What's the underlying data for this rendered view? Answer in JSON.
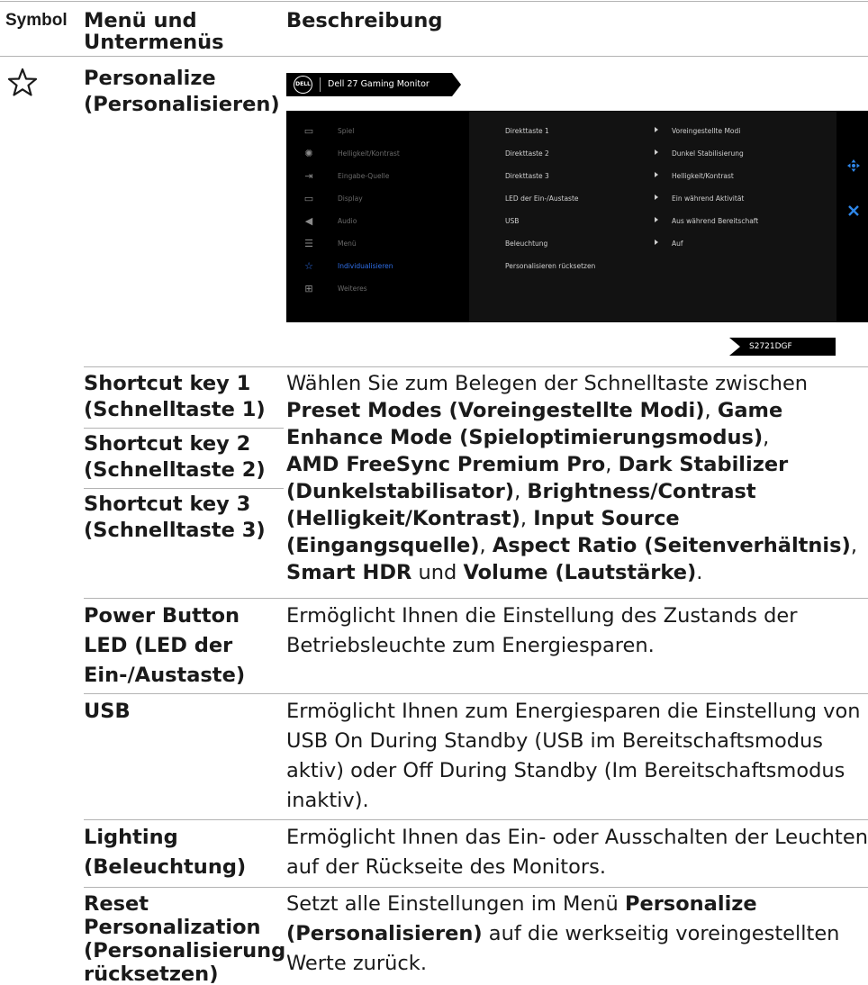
{
  "table": {
    "headers": {
      "symbol": "Symbol",
      "menu": "Menü und Untermenüs",
      "menu_line1": "Menü und",
      "menu_line2": "Untermenüs",
      "description": "Beschreibung"
    },
    "section": {
      "icon": "star-outline",
      "title_line1": "Personalize",
      "title_line2": "(Personalisieren)"
    }
  },
  "osd": {
    "brand": "DELL",
    "model_title": "Dell 27 Gaming Monitor",
    "model_code": "S2721DGF",
    "menu_items": [
      {
        "label": "Spiel",
        "icon": "game-icon"
      },
      {
        "label": "Helligkeit/Kontrast",
        "icon": "brightness-icon"
      },
      {
        "label": "Eingabe-Quelle",
        "icon": "input-icon"
      },
      {
        "label": "Display",
        "icon": "display-icon"
      },
      {
        "label": "Audio",
        "icon": "audio-icon"
      },
      {
        "label": "Menü",
        "icon": "menu-icon"
      },
      {
        "label": "Individualisieren",
        "icon": "star-icon",
        "active": true
      },
      {
        "label": "Weiteres",
        "icon": "others-icon"
      }
    ],
    "submenu": [
      {
        "label": "Direkttaste 1",
        "value": "Voreingestellte Modi"
      },
      {
        "label": "Direkttaste 2",
        "value": "Dunkel Stabilisierung"
      },
      {
        "label": "Direkttaste 3",
        "value": "Helligkeit/Kontrast"
      },
      {
        "label": "LED der Ein-/Austaste",
        "value": "Ein während Aktivität"
      },
      {
        "label": "USB",
        "value": "Aus während Bereitschaft"
      },
      {
        "label": "Beleuchtung",
        "value": "Auf"
      },
      {
        "label": "Personalisieren rücksetzen",
        "value": ""
      }
    ],
    "accent_color": "#2f6fe8"
  },
  "rows": {
    "shortcut": {
      "k1a": "Shortcut key 1",
      "k1b": "(Schnelltaste 1)",
      "k2a": "Shortcut key 2",
      "k2b": "(Schnelltaste 2)",
      "k3a": "Shortcut key 3",
      "k3b": "(Schnelltaste 3)",
      "desc": {
        "l1": "Wählen Sie zum Belegen der Schnelltaste zwischen",
        "l2a": "Preset Modes (Voreingestellte Modi)",
        "l2b": ", ",
        "l2c": "Game",
        "l3a": "Enhance Mode (Spieloptimierungsmodus)",
        "l3b": ",",
        "l4a": "AMD FreeSync Premium Pro",
        "l4b": ", ",
        "l4c": "Dark Stabilizer",
        "l5a": "(Dunkelstabilisator)",
        "l5b": ", ",
        "l5c": "Brightness/Contrast",
        "l6a": "(Helligkeit/Kontrast)",
        "l6b": ", ",
        "l6c": "Input Source",
        "l7a": "(Eingangsquelle)",
        "l7b": ", ",
        "l7c": "Aspect Ratio (Seitenverhältnis)",
        "l7d": ",",
        "l8a": "Smart HDR",
        "l8b": " und ",
        "l8c": "Volume (Lautstärke)",
        "l8d": "."
      }
    },
    "power_led": {
      "n1": "Power Button",
      "n2": "LED (LED der",
      "n3": "Ein-/Austaste)",
      "d1": "Ermöglicht Ihnen die Einstellung des Zustands der",
      "d2": "Betriebsleuchte zum Energiesparen."
    },
    "usb": {
      "name": "USB",
      "d1": "Ermöglicht Ihnen zum Energiesparen die Einstellung von",
      "d2": "USB On During Standby (USB im Bereitschaftsmodus",
      "d3": "aktiv) oder Off During Standby (Im Bereitschaftsmodus",
      "d4": "inaktiv)."
    },
    "lighting": {
      "n1": "Lighting",
      "n2": "(Beleuchtung)",
      "d1": "Ermöglicht Ihnen das Ein- oder Ausschalten der Leuchten",
      "d2": "auf der Rückseite des Monitors."
    },
    "reset": {
      "n1": "Reset",
      "n2": "Personalization",
      "n3": "(Personalisierung",
      "n4": "rücksetzen)",
      "d1a": "Setzt alle Einstellungen im Menü ",
      "d1b": "Personalize",
      "d2a": "(Personalisieren)",
      "d2b": " auf die werkseitig voreingestellten",
      "d3": "Werte zurück."
    }
  }
}
